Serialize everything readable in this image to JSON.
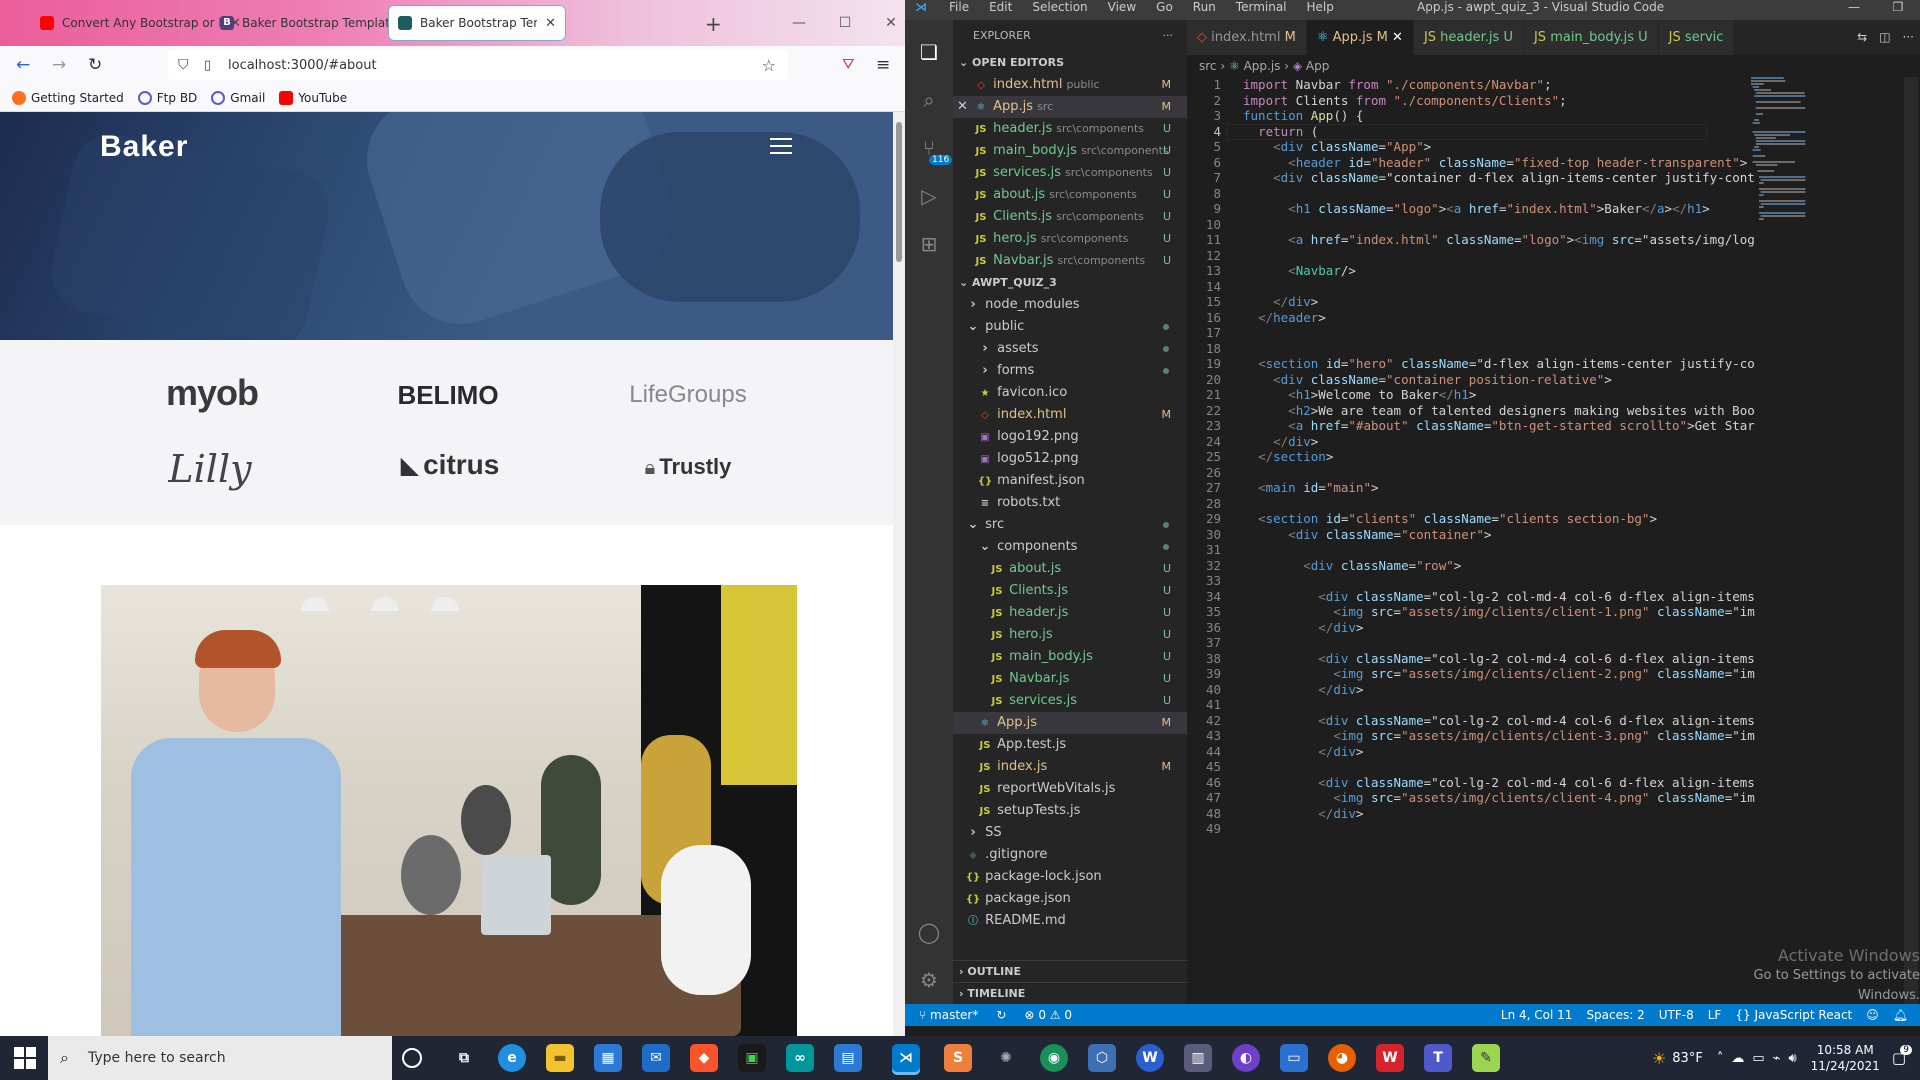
{
  "browser": {
    "tabs": [
      {
        "title": "Convert Any Bootstrap or HTM",
        "icon": "youtube-icon",
        "color": "#ff0000"
      },
      {
        "title": "Baker Bootstrap Template - In",
        "icon": "bootstrap-icon",
        "color": "#563d7c"
      },
      {
        "title": "Baker Bootstrap Template - In",
        "icon": "site-icon",
        "color": "#1d5d5d"
      }
    ],
    "url": "localhost:3000/#about",
    "bookmarks": [
      {
        "label": "Getting Started",
        "color": "#ff6f1c"
      },
      {
        "label": "Ftp BD",
        "color": "#5b5bd6"
      },
      {
        "label": "Gmail",
        "color": "#5b5bd6"
      },
      {
        "label": "YouTube",
        "color": "#ff0000"
      }
    ],
    "page": {
      "logo": "Baker",
      "clients": [
        "myob",
        "BELIMO",
        "LifeGroups",
        "Lilly",
        "citrus",
        "Trustly"
      ]
    }
  },
  "vscode": {
    "title": "App.js - awpt_quiz_3 - Visual Studio Code",
    "menu": [
      "File",
      "Edit",
      "Selection",
      "View",
      "Go",
      "Run",
      "Terminal",
      "Help"
    ],
    "scm_badge": "116",
    "explorer_title": "EXPLORER",
    "open_editors_label": "OPEN EDITORS",
    "open_editors": [
      {
        "name": "index.html",
        "desc": "public",
        "status": "M",
        "kind": "html"
      },
      {
        "name": "App.js",
        "desc": "src",
        "status": "M",
        "kind": "react",
        "selected": true
      },
      {
        "name": "header.js",
        "desc": "src\\components",
        "status": "U",
        "kind": "js"
      },
      {
        "name": "main_body.js",
        "desc": "src\\components",
        "status": "U",
        "kind": "js"
      },
      {
        "name": "services.js",
        "desc": "src\\components",
        "status": "U",
        "kind": "js"
      },
      {
        "name": "about.js",
        "desc": "src\\components",
        "status": "U",
        "kind": "js"
      },
      {
        "name": "Clients.js",
        "desc": "src\\components",
        "status": "U",
        "kind": "js"
      },
      {
        "name": "hero.js",
        "desc": "src\\components",
        "status": "U",
        "kind": "js"
      },
      {
        "name": "Navbar.js",
        "desc": "src\\components",
        "status": "U",
        "kind": "js"
      }
    ],
    "project_label": "AWPT_QUIZ_3",
    "tree": [
      {
        "name": "node_modules",
        "depth": 1,
        "type": "folder-closed"
      },
      {
        "name": "public",
        "depth": 1,
        "type": "folder-open",
        "dot": true
      },
      {
        "name": "assets",
        "depth": 2,
        "type": "folder-closed",
        "dot": true
      },
      {
        "name": "forms",
        "depth": 2,
        "type": "folder-closed",
        "dot": true
      },
      {
        "name": "favicon.ico",
        "depth": 2,
        "type": "star"
      },
      {
        "name": "index.html",
        "depth": 2,
        "type": "html",
        "status": "M"
      },
      {
        "name": "logo192.png",
        "depth": 2,
        "type": "img"
      },
      {
        "name": "logo512.png",
        "depth": 2,
        "type": "img"
      },
      {
        "name": "manifest.json",
        "depth": 2,
        "type": "json"
      },
      {
        "name": "robots.txt",
        "depth": 2,
        "type": "txt"
      },
      {
        "name": "src",
        "depth": 1,
        "type": "folder-open",
        "dot": true
      },
      {
        "name": "components",
        "depth": 2,
        "type": "folder-open",
        "dot": true
      },
      {
        "name": "about.js",
        "depth": 3,
        "type": "js",
        "status": "U"
      },
      {
        "name": "Clients.js",
        "depth": 3,
        "type": "js",
        "status": "U"
      },
      {
        "name": "header.js",
        "depth": 3,
        "type": "js",
        "status": "U"
      },
      {
        "name": "hero.js",
        "depth": 3,
        "type": "js",
        "status": "U"
      },
      {
        "name": "main_body.js",
        "depth": 3,
        "type": "js",
        "status": "U"
      },
      {
        "name": "Navbar.js",
        "depth": 3,
        "type": "js",
        "status": "U"
      },
      {
        "name": "services.js",
        "depth": 3,
        "type": "js",
        "status": "U"
      },
      {
        "name": "App.js",
        "depth": 2,
        "type": "react",
        "status": "M",
        "selected": true
      },
      {
        "name": "App.test.js",
        "depth": 2,
        "type": "js"
      },
      {
        "name": "index.js",
        "depth": 2,
        "type": "js",
        "status": "M"
      },
      {
        "name": "reportWebVitals.js",
        "depth": 2,
        "type": "js"
      },
      {
        "name": "setupTests.js",
        "depth": 2,
        "type": "js"
      },
      {
        "name": "SS",
        "depth": 1,
        "type": "folder-closed"
      },
      {
        "name": ".gitignore",
        "depth": 1,
        "type": "git"
      },
      {
        "name": "package-lock.json",
        "depth": 1,
        "type": "json"
      },
      {
        "name": "package.json",
        "depth": 1,
        "type": "json"
      },
      {
        "name": "README.md",
        "depth": 1,
        "type": "md"
      }
    ],
    "outline_label": "OUTLINE",
    "timeline_label": "TIMELINE",
    "editor_tabs": [
      {
        "name": "index.html",
        "status": "M"
      },
      {
        "name": "App.js",
        "status": "M",
        "active": true
      },
      {
        "name": "header.js",
        "status": "U"
      },
      {
        "name": "main_body.js",
        "status": "U"
      },
      {
        "name": "servic",
        "status": ""
      }
    ],
    "breadcrumb": [
      "src",
      "App.js",
      "App"
    ],
    "code": [
      "import Navbar from \"./components/Navbar\";",
      "import Clients from \"./components/Clients\";",
      "function App() {",
      "  return (",
      "    <div className=\"App\">",
      "      <header id=\"header\" className=\"fixed-top header-transparent\">",
      "    <div className=\"container d-flex align-items-center justify-cont",
      "",
      "      <h1 className=\"logo\"><a href=\"index.html\">Baker</a></h1>",
      "",
      "      <a href=\"index.html\" className=\"logo\"><img src=\"assets/img/log",
      "",
      "      <Navbar/>",
      "",
      "    </div>",
      "  </header>",
      "",
      "",
      "  <section id=\"hero\" className=\"d-flex align-items-center justify-co",
      "    <div className=\"container position-relative\">",
      "      <h1>Welcome to Baker</h1>",
      "      <h2>We are team of talented designers making websites with Boo",
      "      <a href=\"#about\" className=\"btn-get-started scrollto\">Get Star",
      "    </div>",
      "  </section>",
      "",
      "  <main id=\"main\">",
      "",
      "  <section id=\"clients\" className=\"clients section-bg\">",
      "      <div className=\"container\">",
      "",
      "        <div className=\"row\">",
      "",
      "          <div className=\"col-lg-2 col-md-4 col-6 d-flex align-items",
      "            <img src=\"assets/img/clients/client-1.png\" className=\"im",
      "          </div>",
      "",
      "          <div className=\"col-lg-2 col-md-4 col-6 d-flex align-items",
      "            <img src=\"assets/img/clients/client-2.png\" className=\"im",
      "          </div>",
      "",
      "          <div className=\"col-lg-2 col-md-4 col-6 d-flex align-items",
      "            <img src=\"assets/img/clients/client-3.png\" className=\"im",
      "          </div>",
      "",
      "          <div className=\"col-lg-2 col-md-4 col-6 d-flex align-items",
      "            <img src=\"assets/img/clients/client-4.png\" className=\"im",
      "          </div>",
      ""
    ],
    "current_line": 4,
    "activate_title": "Activate Windows",
    "activate_sub": "Go to Settings to activate Windows.",
    "status": {
      "branch": "master*",
      "errors": "0",
      "warnings": "0",
      "position": "Ln 4, Col 11",
      "spaces": "Spaces: 2",
      "encoding": "UTF-8",
      "eol": "LF",
      "language": "JavaScript React"
    }
  },
  "taskbar": {
    "search_placeholder": "Type here to search",
    "temperature": "83°F",
    "time": "10:58 AM",
    "date": "11/24/2021",
    "notifications": "9"
  }
}
